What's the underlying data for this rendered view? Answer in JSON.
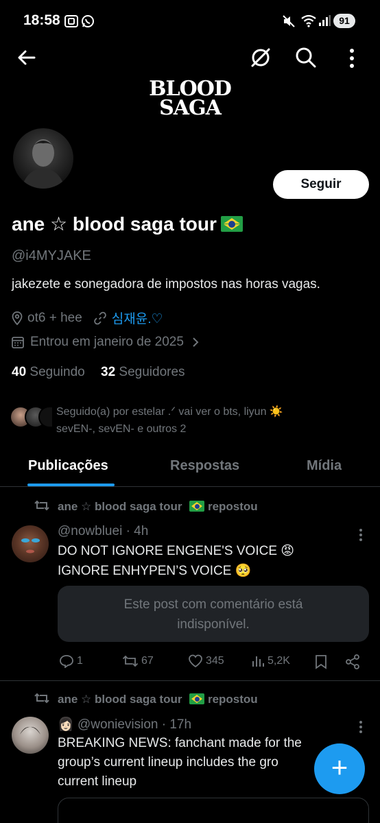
{
  "status_bar": {
    "time": "18:58",
    "battery": "91"
  },
  "header": {
    "banner_line1": "BLOOD",
    "banner_line2": "SAGA"
  },
  "profile": {
    "follow_label": "Seguir",
    "display_name": "ane ☆ blood saga tour",
    "handle": "@i4MYJAKE",
    "bio": "jakezete e sonegadora de impostos nas horas vagas.",
    "location": "ot6 + hee",
    "link_text": "심재윤.♡",
    "joined": "Entrou em janeiro de 2025",
    "following_count": "40",
    "following_label": "Seguindo",
    "followers_count": "32",
    "followers_label": "Seguidores",
    "followed_by_line1": "Seguido(a) por estelar .ᐟ vai ver o bts, liyun ☀️",
    "followed_by_line2": "sevEN-, sevEN- e outros 2"
  },
  "tabs": [
    {
      "label": "Publicações",
      "active": true
    },
    {
      "label": "Respostas",
      "active": false
    },
    {
      "label": "Mídia",
      "active": false
    }
  ],
  "posts": [
    {
      "repost_label": "ane ☆ blood saga tour",
      "repost_suffix": "repostou",
      "author_handle": "@nowbluei · 4h",
      "line1": "DO NOT IGNORE ENGENE'S VOICE 😡",
      "line2": "IGNORE ENHYPEN’S VOICE 🥺",
      "quote_line1": "Este post com comentário está",
      "quote_line2": "indisponível.",
      "replies": "1",
      "reposts": "67",
      "likes": "345",
      "views": "5,2K"
    },
    {
      "repost_label": "ane ☆ blood saga tour",
      "repost_suffix": "repostou",
      "author_prefix": "👩🏻",
      "author_handle": "@wonievision · 17h",
      "line1": "BREAKING NEWS: fanchant made for the",
      "line2": "group’s current lineup includes the gro",
      "line3": "current lineup"
    }
  ],
  "fab_label": "+",
  "colors": {
    "accent": "#1d9bf0",
    "background": "#000000",
    "muted": "#71767b",
    "quote_bg": "#202327"
  }
}
